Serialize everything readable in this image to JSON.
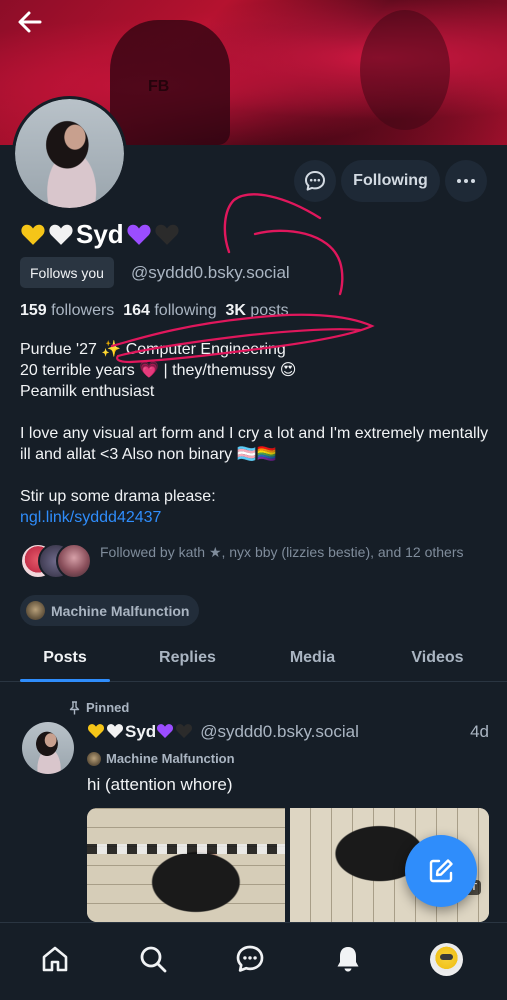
{
  "profile": {
    "display_name": "Syd",
    "follows_you_label": "Follows you",
    "handle": "@syddd0.bsky.social",
    "following_label": "Following",
    "heart_colors": {
      "yellow": "#f5c518",
      "white": "#f2f2f2",
      "purple": "#9b4dff",
      "black": "#2b2b2b"
    }
  },
  "stats": {
    "followers_count": "159",
    "followers_label": "followers",
    "following_count": "164",
    "following_label": "following",
    "posts_count": "3K",
    "posts_label": "posts"
  },
  "bio": {
    "line1": "Purdue '27 ✨ Computer Engineering",
    "line2": "20 terrible years 💗 | they/themussy 😍",
    "line3": "Peamilk enthusiast",
    "line4": "I love any visual art form and I cry a lot and I'm extremely mentally ill and allat <3 Also non binary 🏳️‍⚧️🏳️‍🌈",
    "line5": "Stir up some drama please:",
    "link": "ngl.link/syddd42437"
  },
  "followed_by": "Followed by kath ★, nyx bby (lizzies bestie), and 12 others",
  "labeler": "Machine Malfunction",
  "tabs": [
    {
      "label": "Posts",
      "active": true
    },
    {
      "label": "Replies",
      "active": false
    },
    {
      "label": "Media",
      "active": false
    },
    {
      "label": "Videos",
      "active": false
    }
  ],
  "post": {
    "pinned_label": "Pinned",
    "author_name": "Syd",
    "author_handle": "@syddd0.bsky.social",
    "time": "4d",
    "labeler": "Machine Malfunction",
    "text": "hi (attention whore)",
    "alt_badge": "ALT"
  },
  "nav": {
    "items": [
      "home-icon",
      "search-icon",
      "chat-icon",
      "notifications-icon",
      "profile-avatar"
    ]
  },
  "colors": {
    "background": "#161e27",
    "accent": "#2f8dfb",
    "banner": "#b5122f",
    "annotation": "#e0175c"
  }
}
